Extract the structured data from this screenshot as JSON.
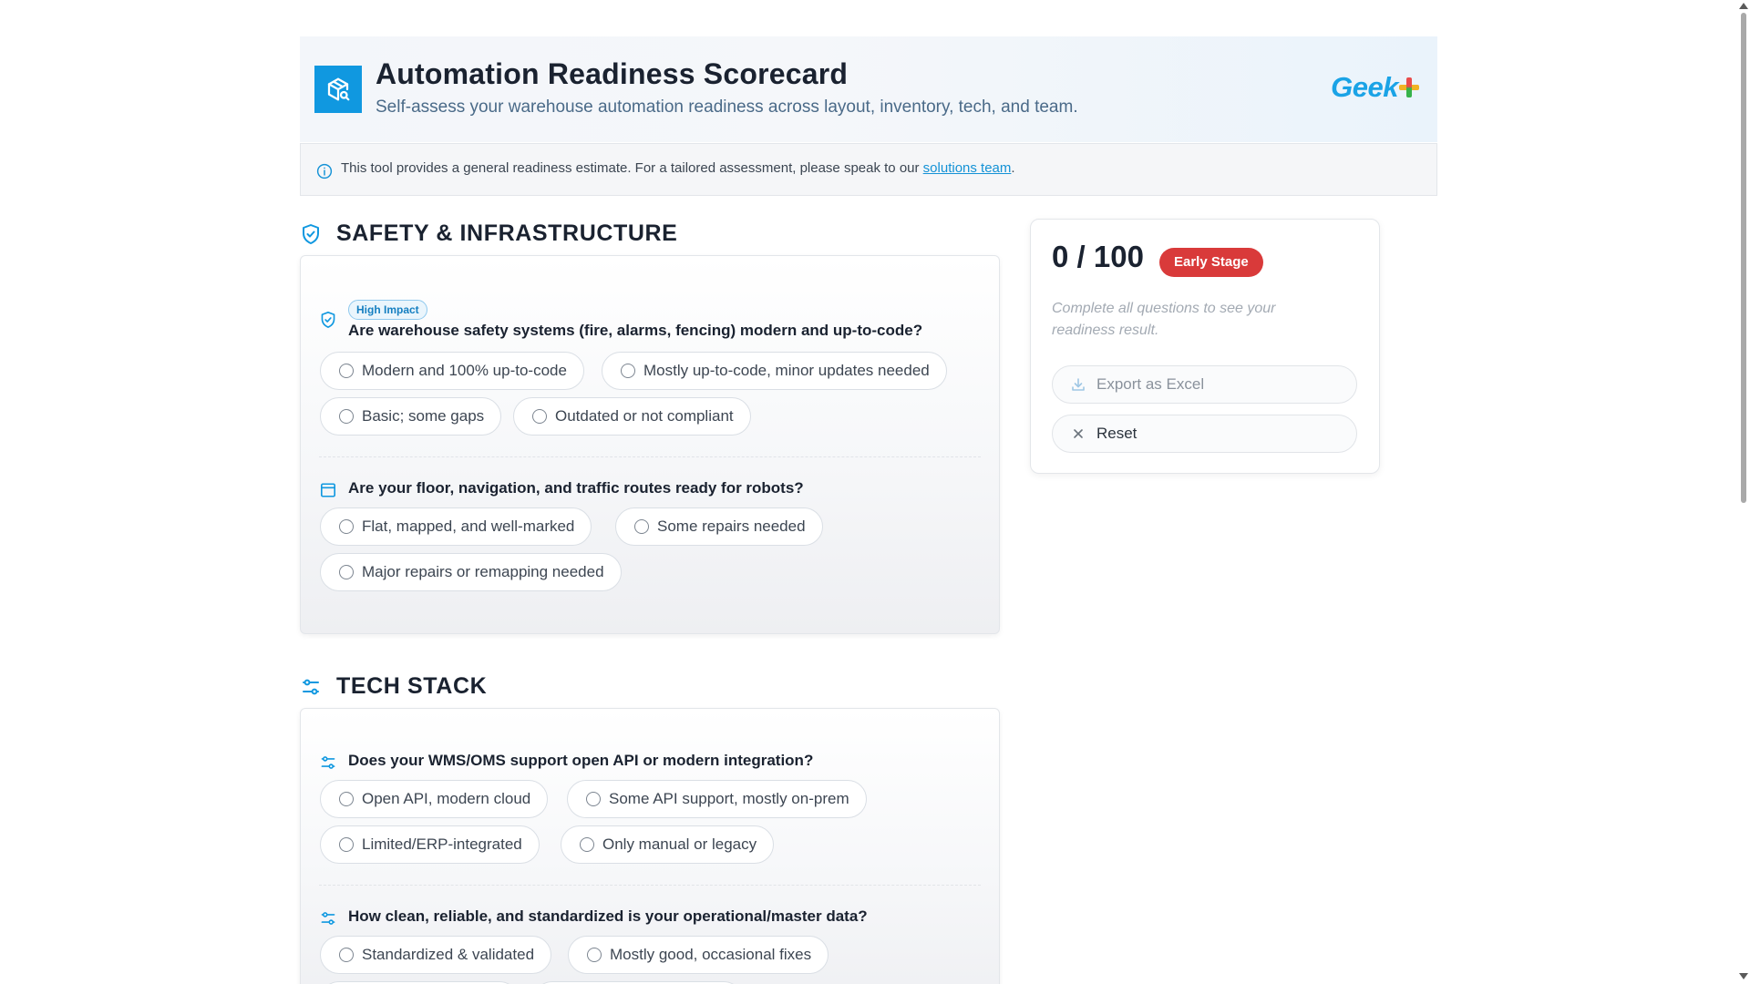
{
  "header": {
    "title": "Automation Readiness Scorecard",
    "subtitle": "Self-assess your warehouse automation readiness across layout, inventory, tech, and team.",
    "brand": "Geek"
  },
  "notice": {
    "text": "This tool provides a general readiness estimate. For a tailored assessment, please speak to our ",
    "link": "solutions team",
    "end": "."
  },
  "sections": [
    {
      "title": "SAFETY & INFRASTRUCTURE",
      "icon": "shield-check-icon",
      "questions": [
        {
          "badge": "High Impact",
          "icon": "shield-check-icon",
          "text": "Are warehouse safety systems (fire, alarms, fencing) modern and up-to-code?",
          "options": [
            "Modern and 100% up-to-code",
            "Mostly up-to-code, minor updates needed",
            "Basic; some gaps",
            "Outdated or not compliant"
          ]
        },
        {
          "icon": "layout-icon",
          "text": "Are your floor, navigation, and traffic routes ready for robots?",
          "options": [
            "Flat, mapped, and well-marked",
            "Some repairs needed",
            "Major repairs or remapping needed"
          ]
        }
      ]
    },
    {
      "title": "TECH STACK",
      "icon": "sliders-icon",
      "questions": [
        {
          "icon": "sliders-icon",
          "text": "Does your WMS/OMS support open API or modern integration?",
          "options": [
            "Open API, modern cloud",
            "Some API support, mostly on-prem",
            "Limited/ERP-integrated",
            "Only manual or legacy"
          ]
        },
        {
          "icon": "sliders-icon",
          "text": "How clean, reliable, and standardized is your operational/master data?",
          "options": [
            "Standardized & validated",
            "Mostly good, occasional fixes"
          ]
        }
      ]
    }
  ],
  "score": {
    "value": "0 / 100",
    "stage": "Early Stage",
    "note": "Complete all questions to see your readiness result.",
    "export_label": "Export as Excel",
    "reset_label": "Reset"
  },
  "colors": {
    "accent": "#1098e0",
    "stage_badge": "#d93a3a",
    "link": "#1492d6"
  }
}
